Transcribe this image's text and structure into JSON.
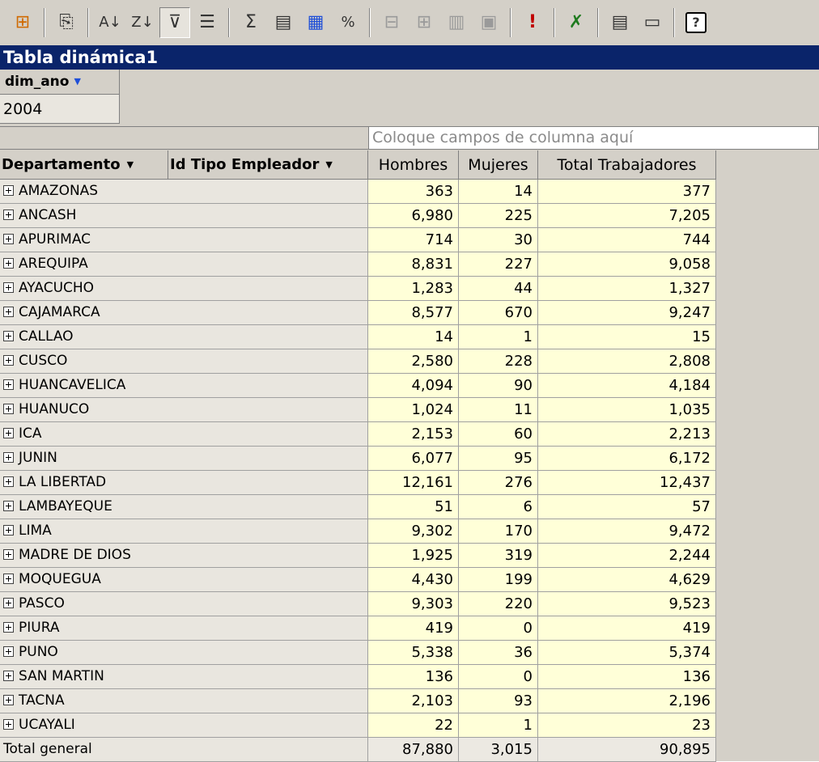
{
  "toolbar": {
    "icons": [
      "pivot-table-icon",
      "copy-icon",
      "sort-ascending-icon",
      "sort-descending-icon",
      "autofilter-icon",
      "show-top-bottom-icon",
      "autocalc-icon",
      "subtotal-icon",
      "calculated-totals-icon",
      "show-as-icon",
      "collapse-icon",
      "expand-icon",
      "hide-details-icon",
      "show-details-icon",
      "refresh-icon",
      "export-to-excel-icon",
      "field-list-icon",
      "property-toolbox-icon",
      "help-icon"
    ]
  },
  "title": "Tabla dinámica1",
  "filter": {
    "field": "dim_ano",
    "value": "2004"
  },
  "column_drop_hint": "Coloque campos de columna aquí",
  "headers": {
    "row_field_1": "Departamento",
    "row_field_2": "Id Tipo Empleador",
    "col_hombres": "Hombres",
    "col_mujeres": "Mujeres",
    "col_total": "Total Trabajadores"
  },
  "rows": [
    {
      "dept": "AMAZONAS",
      "hombres": "363",
      "mujeres": "14",
      "total": "377"
    },
    {
      "dept": "ANCASH",
      "hombres": "6,980",
      "mujeres": "225",
      "total": "7,205"
    },
    {
      "dept": "APURIMAC",
      "hombres": "714",
      "mujeres": "30",
      "total": "744"
    },
    {
      "dept": "AREQUIPA",
      "hombres": "8,831",
      "mujeres": "227",
      "total": "9,058"
    },
    {
      "dept": "AYACUCHO",
      "hombres": "1,283",
      "mujeres": "44",
      "total": "1,327"
    },
    {
      "dept": "CAJAMARCA",
      "hombres": "8,577",
      "mujeres": "670",
      "total": "9,247"
    },
    {
      "dept": "CALLAO",
      "hombres": "14",
      "mujeres": "1",
      "total": "15"
    },
    {
      "dept": "CUSCO",
      "hombres": "2,580",
      "mujeres": "228",
      "total": "2,808"
    },
    {
      "dept": "HUANCAVELICA",
      "hombres": "4,094",
      "mujeres": "90",
      "total": "4,184"
    },
    {
      "dept": "HUANUCO",
      "hombres": "1,024",
      "mujeres": "11",
      "total": "1,035"
    },
    {
      "dept": "ICA",
      "hombres": "2,153",
      "mujeres": "60",
      "total": "2,213"
    },
    {
      "dept": "JUNIN",
      "hombres": "6,077",
      "mujeres": "95",
      "total": "6,172"
    },
    {
      "dept": "LA LIBERTAD",
      "hombres": "12,161",
      "mujeres": "276",
      "total": "12,437"
    },
    {
      "dept": "LAMBAYEQUE",
      "hombres": "51",
      "mujeres": "6",
      "total": "57"
    },
    {
      "dept": "LIMA",
      "hombres": "9,302",
      "mujeres": "170",
      "total": "9,472"
    },
    {
      "dept": "MADRE DE DIOS",
      "hombres": "1,925",
      "mujeres": "319",
      "total": "2,244"
    },
    {
      "dept": "MOQUEGUA",
      "hombres": "4,430",
      "mujeres": "199",
      "total": "4,629"
    },
    {
      "dept": "PASCO",
      "hombres": "9,303",
      "mujeres": "220",
      "total": "9,523"
    },
    {
      "dept": "PIURA",
      "hombres": "419",
      "mujeres": "0",
      "total": "419"
    },
    {
      "dept": "PUNO",
      "hombres": "5,338",
      "mujeres": "36",
      "total": "5,374"
    },
    {
      "dept": "SAN MARTIN",
      "hombres": "136",
      "mujeres": "0",
      "total": "136"
    },
    {
      "dept": "TACNA",
      "hombres": "2,103",
      "mujeres": "93",
      "total": "2,196"
    },
    {
      "dept": "UCAYALI",
      "hombres": "22",
      "mujeres": "1",
      "total": "23"
    }
  ],
  "grand_total": {
    "label": "Total general",
    "hombres": "87,880",
    "mujeres": "3,015",
    "total": "90,895"
  },
  "colors": {
    "title_bar": "#0a246a",
    "data_cell": "#ffffd8",
    "chrome": "#d4d0c8"
  }
}
